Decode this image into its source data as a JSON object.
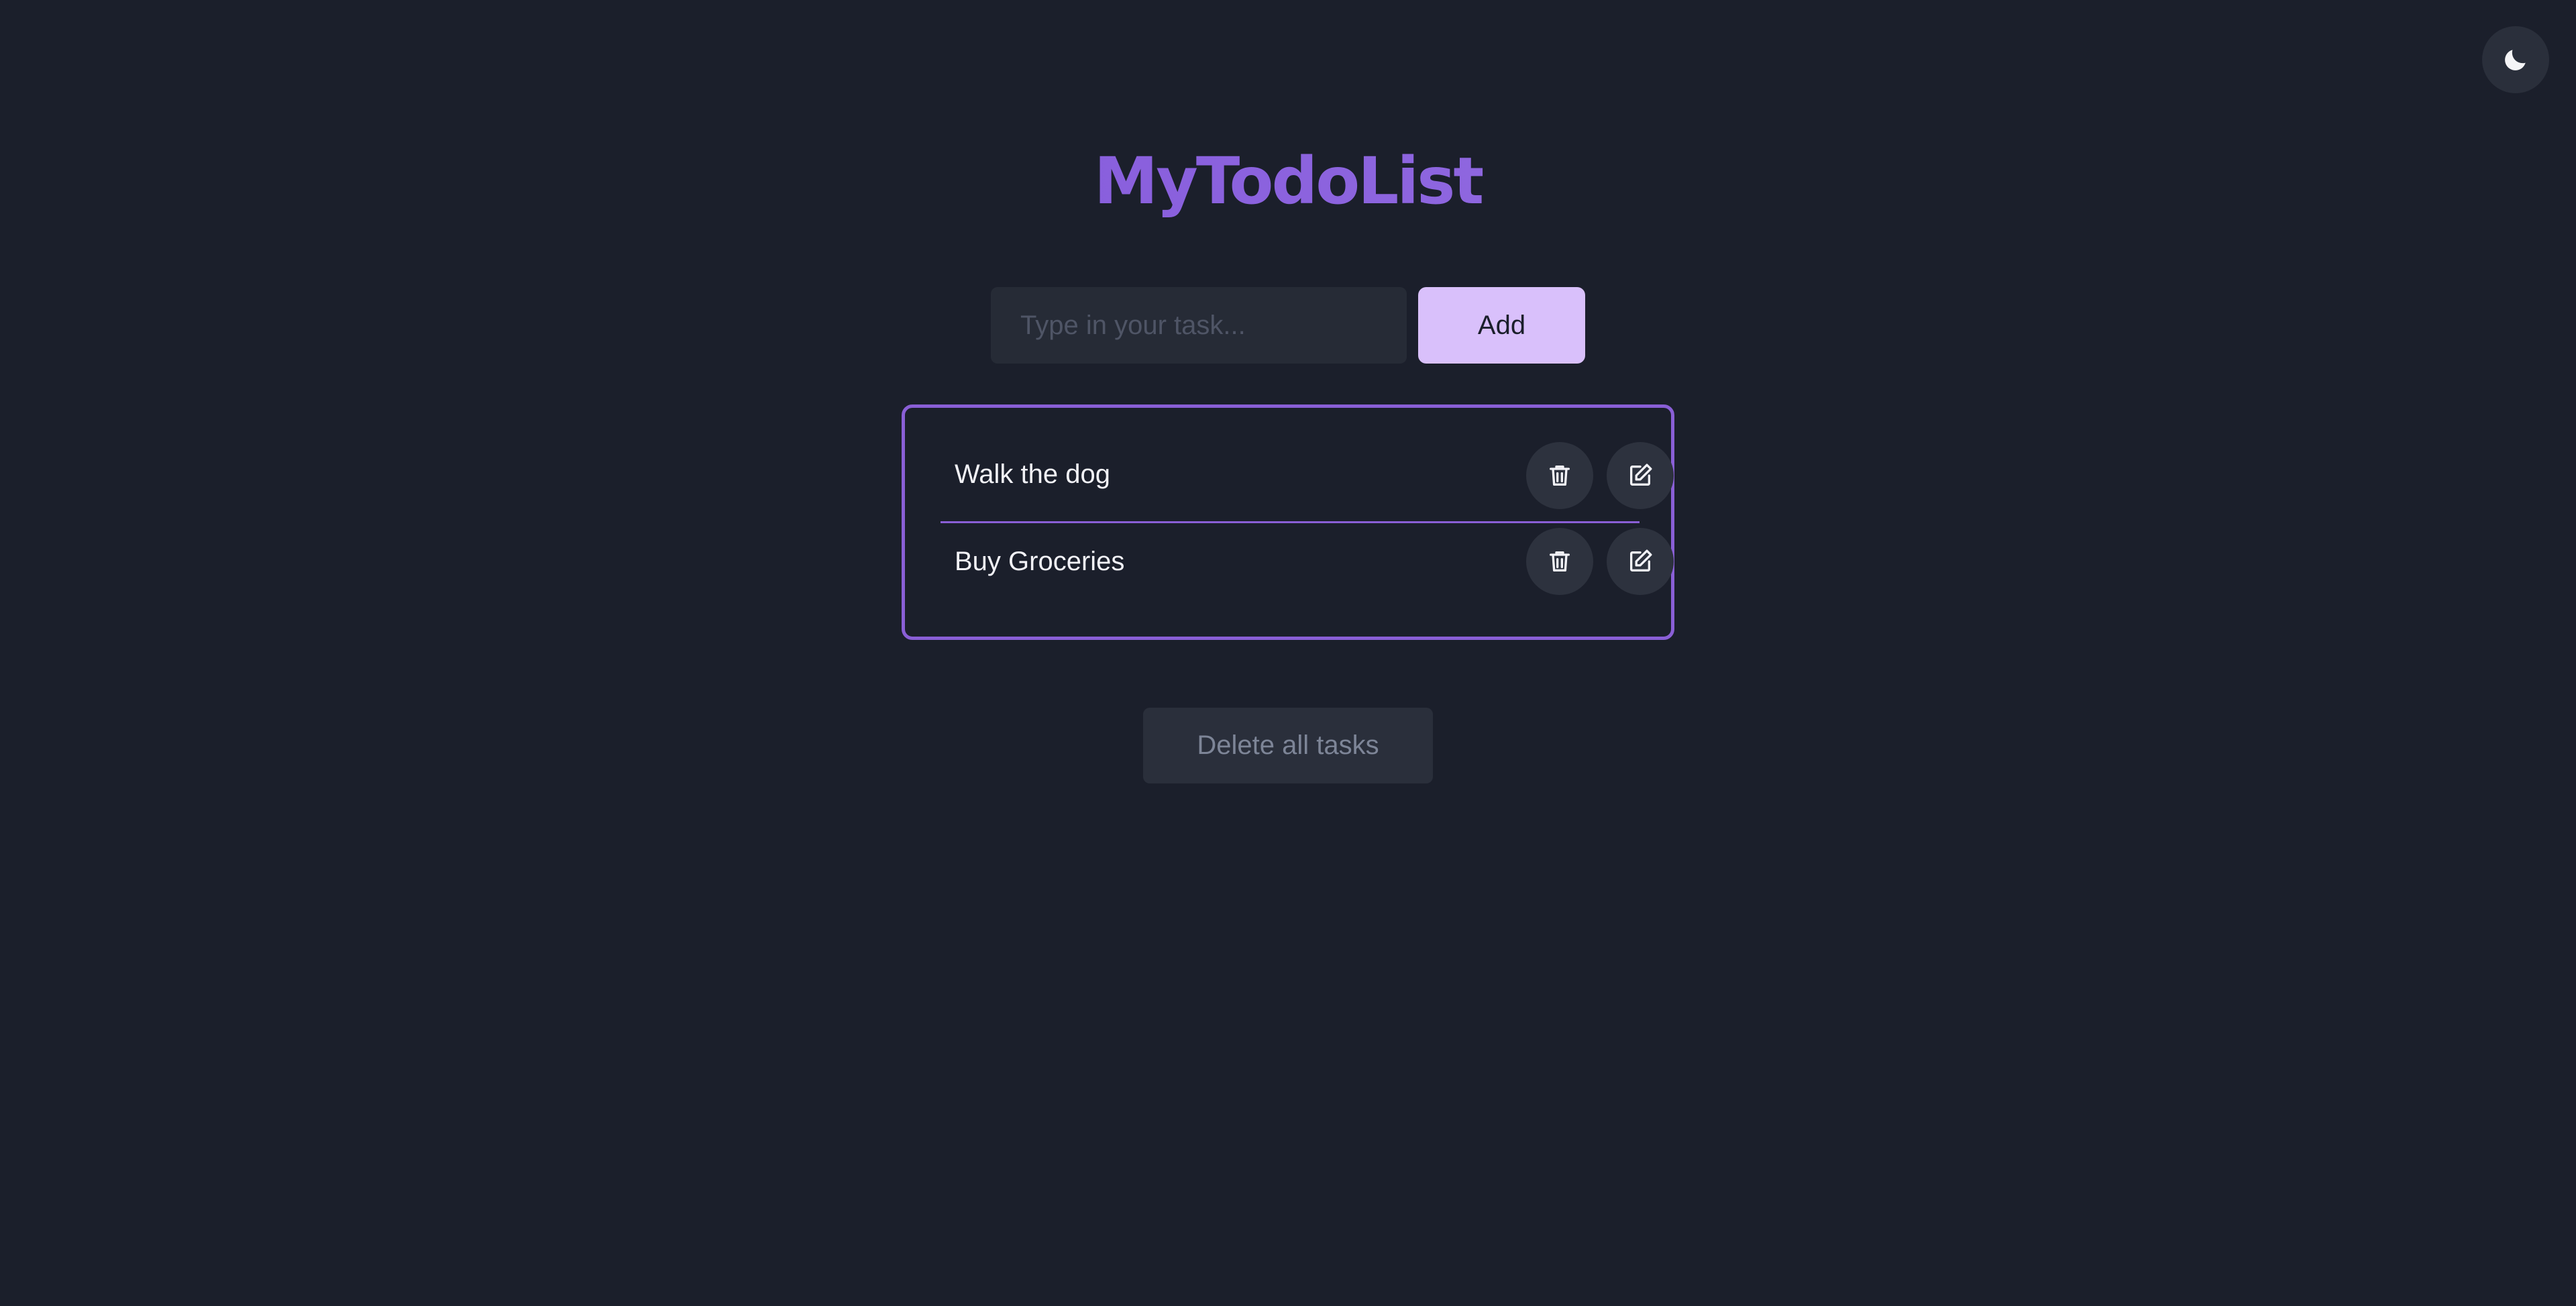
{
  "app": {
    "title": "MyTodoList",
    "theme_toggle_icon": "moon-icon"
  },
  "input": {
    "placeholder": "Type in your task...",
    "value": ""
  },
  "add_button": {
    "label": "Add"
  },
  "tasks": [
    {
      "text": "Walk the dog",
      "delete_icon": "trash-icon",
      "edit_icon": "edit-icon"
    },
    {
      "text": "Buy Groceries",
      "delete_icon": "trash-icon",
      "edit_icon": "edit-icon"
    }
  ],
  "delete_all_button": {
    "label": "Delete all tasks"
  },
  "colors": {
    "background": "#1b1f2b",
    "accent": "#8a5fd6",
    "add_button": "#d9c0fb",
    "input_background": "#262b36",
    "icon_button": "#2d323e",
    "muted_text": "#7d8597"
  }
}
